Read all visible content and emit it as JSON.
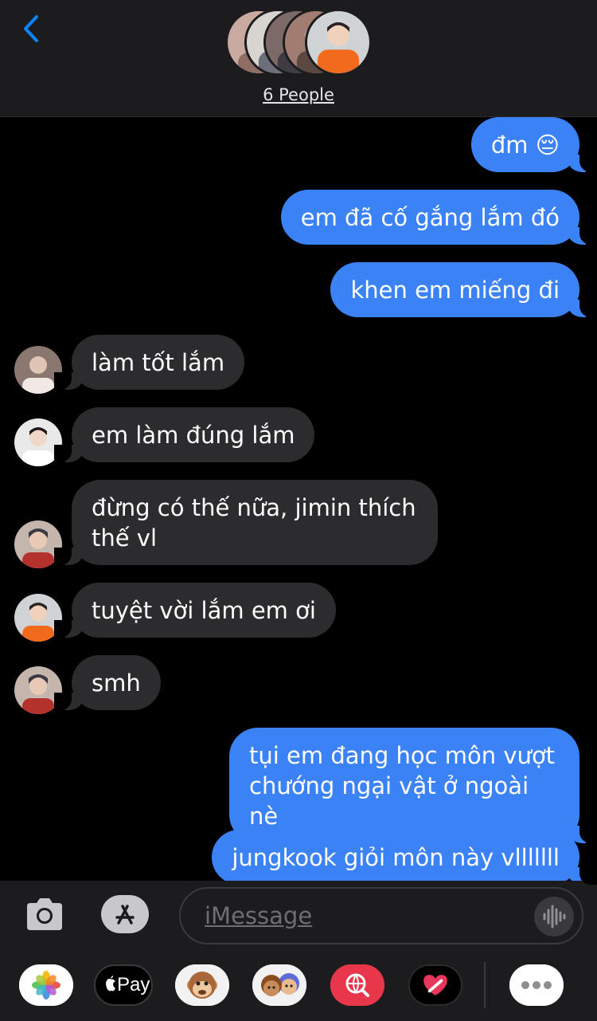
{
  "header": {
    "people_label": "6 People"
  },
  "messages": {
    "m1": "đm 😔",
    "m2": "em đã cố gắng lắm đó",
    "m3": "khen em miếng đi",
    "m4": "làm tốt lắm",
    "m5": "em làm đúng lắm",
    "m6": "đừng có thế nữa, jimin thích thế vl",
    "m7": "tuyệt vời lắm em ơi",
    "m8": "smh",
    "m9": "tụi em đang học môn vượt chướng ngại vật ở ngoài nè",
    "m10": "jungkook giỏi môn này vlllllll"
  },
  "input": {
    "placeholder": "iMessage"
  },
  "drawer": {
    "apple_pay_label": "Pay"
  },
  "colors": {
    "outgoing_bubble": "#3b82f6",
    "incoming_bubble": "#2c2c2e",
    "accent": "#0a84ff"
  },
  "icons": [
    "back-chevron-icon",
    "camera-icon",
    "app-store-icon",
    "audio-waveform-icon",
    "photos-icon",
    "apple-pay-icon",
    "animoji-icon",
    "memoji-icon",
    "search-images-icon",
    "digital-touch-icon",
    "more-icon"
  ]
}
